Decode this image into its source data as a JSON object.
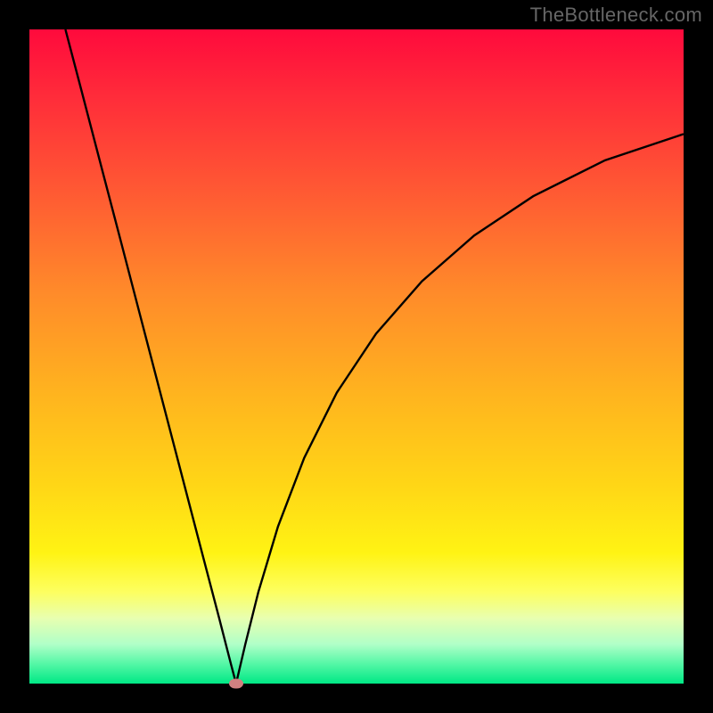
{
  "watermark": "TheBottleneck.com",
  "chart_data": {
    "type": "line",
    "title": "",
    "xlabel": "",
    "ylabel": "",
    "xlim": [
      0,
      100
    ],
    "ylim": [
      0,
      100
    ],
    "grid": false,
    "legend": false,
    "background_gradient": {
      "top_color": "#ff0a3c",
      "bottom_color": "#00e885",
      "description": "vertical gradient red→orange→yellow→green"
    },
    "series": [
      {
        "name": "left-branch",
        "stroke": "#000000",
        "x": [
          5.5,
          8,
          11,
          14,
          17,
          20,
          23,
          26,
          29,
          30.8,
          31.6
        ],
        "y": [
          100,
          90.5,
          79,
          67.5,
          56,
          44.5,
          33,
          21.5,
          10,
          3,
          0
        ]
      },
      {
        "name": "right-branch",
        "stroke": "#000000",
        "x": [
          31.6,
          33,
          35,
          38,
          42,
          47,
          53,
          60,
          68,
          77,
          88,
          100
        ],
        "y": [
          0,
          6,
          14,
          24,
          34.5,
          44.5,
          53.5,
          61.5,
          68.5,
          74.5,
          80,
          84
        ]
      }
    ],
    "marker": {
      "name": "optimum-point",
      "x": 31.6,
      "y": 0,
      "color": "#d08080",
      "shape": "ellipse"
    }
  }
}
